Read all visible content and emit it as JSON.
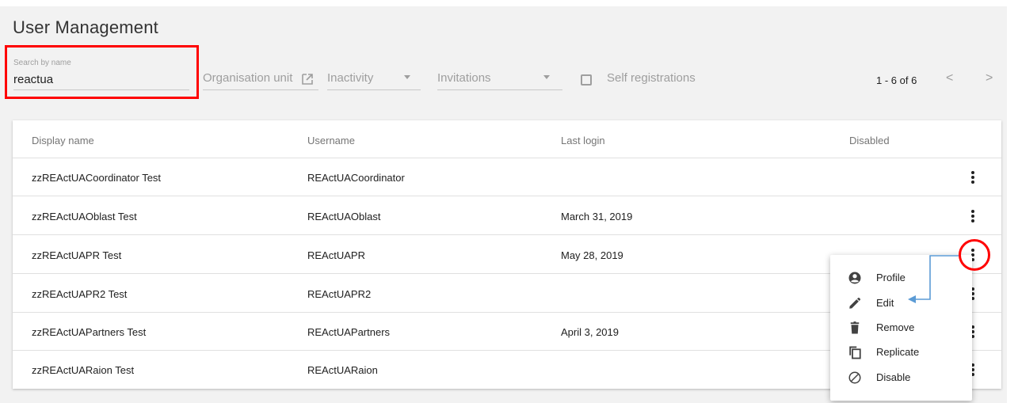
{
  "page": {
    "title": "User Management"
  },
  "search": {
    "label": "Search by name",
    "value": "reactua"
  },
  "filters": {
    "org_unit": "Organisation unit",
    "inactivity": "Inactivity",
    "invitations": "Invitations",
    "self_registrations": "Self registrations"
  },
  "pager": {
    "range": "1 - 6 of 6",
    "prev": "<",
    "next": ">"
  },
  "table": {
    "columns": [
      "Display name",
      "Username",
      "Last login",
      "Disabled"
    ],
    "rows": [
      {
        "display_name": "zzREActUACoordinator Test",
        "username": "REActUACoordinator",
        "last_login": ""
      },
      {
        "display_name": "zzREActUAOblast Test",
        "username": "REActUAOblast",
        "last_login": "March 31, 2019"
      },
      {
        "display_name": "zzREActUAPR Test",
        "username": "REActUAPR",
        "last_login": "May 28, 2019"
      },
      {
        "display_name": "zzREActUAPR2 Test",
        "username": "REActUAPR2",
        "last_login": ""
      },
      {
        "display_name": "zzREActUAPartners Test",
        "username": "REActUAPartners",
        "last_login": "April 3, 2019"
      },
      {
        "display_name": "zzREActUARaion Test",
        "username": "REActUARaion",
        "last_login": ""
      }
    ]
  },
  "context_menu": {
    "items": [
      {
        "label": "Profile",
        "icon": "account-circle-icon"
      },
      {
        "label": "Edit",
        "icon": "pencil-icon"
      },
      {
        "label": "Remove",
        "icon": "trash-icon"
      },
      {
        "label": "Replicate",
        "icon": "copy-icon"
      },
      {
        "label": "Disable",
        "icon": "block-icon"
      }
    ]
  },
  "colors": {
    "highlight": "#ff0000",
    "arrow": "#5b9bd5",
    "page_bg": "#f2f2f2"
  }
}
